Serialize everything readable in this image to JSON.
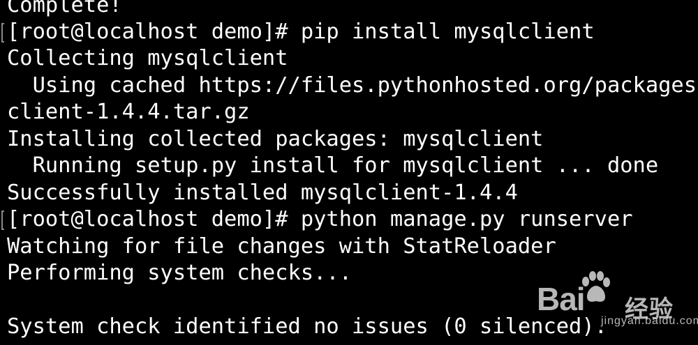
{
  "terminal": {
    "background": "#000000",
    "foreground": "#ffffff",
    "lines": [
      "Complete!",
      "[root@localhost demo]# pip install mysqlclient",
      "Collecting mysqlclient",
      "  Using cached https://files.pythonhosted.org/packages",
      "client-1.4.4.tar.gz",
      "Installing collected packages: mysqlclient",
      "  Running setup.py install for mysqlclient ... done",
      "Successfully installed mysqlclient-1.4.4",
      "[root@localhost demo]# python manage.py runserver",
      "Watching for file changes with StatReloader",
      "Performing system checks...",
      "",
      "System check identified no issues (0 silenced)."
    ]
  },
  "watermark": {
    "brand_latin": "Bai",
    "brand_du": "du",
    "brand_cn": "经验",
    "url": "jingyan.baidu.com",
    "paw_icon": "baidu-paw-icon"
  }
}
